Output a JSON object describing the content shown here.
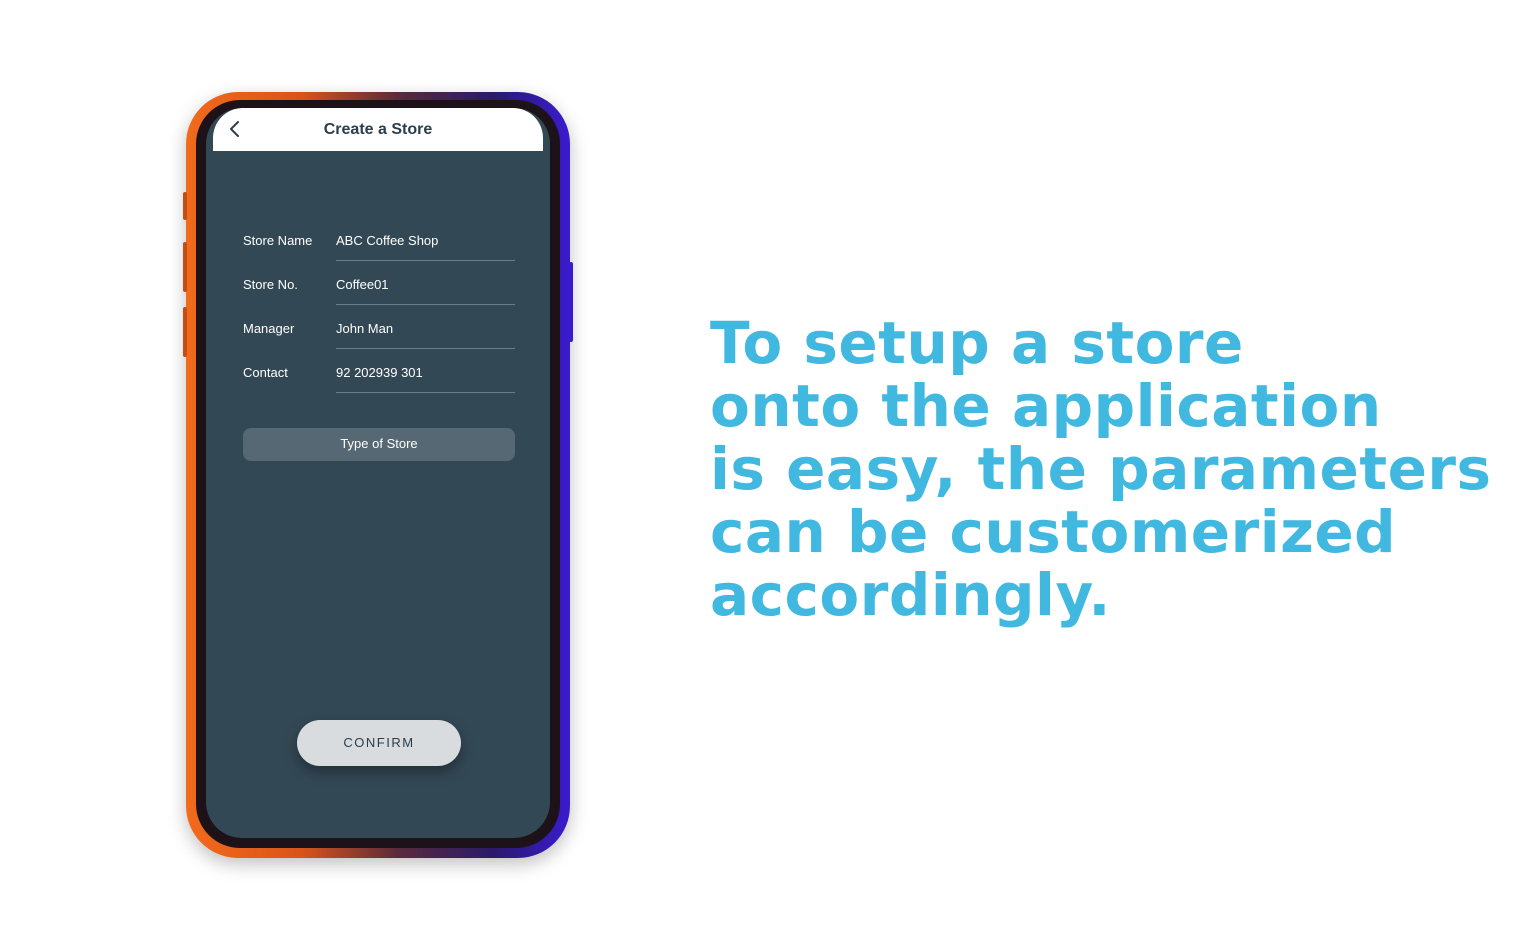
{
  "screen": {
    "title": "Create a Store",
    "back_icon": "chevron-left-icon"
  },
  "form": {
    "fields": [
      {
        "label": "Store Name",
        "value": "ABC Coffee Shop"
      },
      {
        "label": "Store No.",
        "value": "Coffee01"
      },
      {
        "label": "Manager",
        "value": "John Man"
      },
      {
        "label": "Contact",
        "value": "92 202939 301"
      }
    ],
    "type_select_label": "Type of Store",
    "confirm_label": "CONFIRM"
  },
  "headline": {
    "lines": [
      "To setup a store",
      "onto the application",
      "is easy, the parameters",
      "can be customerized",
      "accordingly."
    ]
  },
  "colors": {
    "screen_bg": "#334855",
    "headline": "#41b8e0",
    "frame_left": "#f26a1b",
    "frame_right": "#3a1bd0"
  }
}
